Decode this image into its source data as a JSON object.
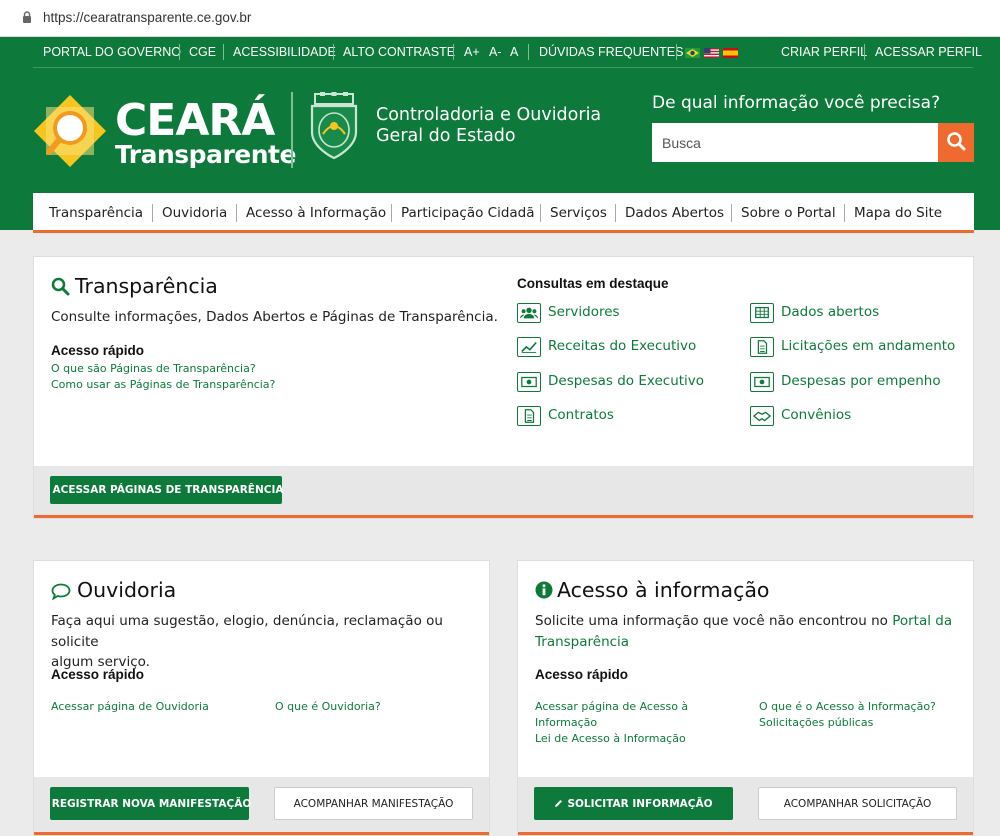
{
  "browser": {
    "url": "https://cearatransparente.ce.gov.br"
  },
  "topbar": {
    "items": [
      "PORTAL DO GOVERNO",
      "CGE",
      "ACESSIBILIDADE",
      "ALTO CONTRASTE",
      "A+",
      "A-",
      "A",
      "DÚVIDAS FREQUENTES"
    ],
    "right": [
      "CRIAR PERFIL",
      "ACESSAR PERFIL"
    ]
  },
  "brand": {
    "name": "CEARÁ",
    "subtitle": "Transparente",
    "org_line1": "Controladoria e Ouvidoria",
    "org_line2": "Geral do Estado"
  },
  "search": {
    "label": "De qual informação você precisa?",
    "placeholder": "Busca"
  },
  "nav": [
    "Transparência",
    "Ouvidoria",
    "Acesso à Informação",
    "Participação Cidadã",
    "Serviços",
    "Dados Abertos",
    "Sobre o Portal",
    "Mapa do Site"
  ],
  "transparencia": {
    "title": "Transparência",
    "description": "Consulte informações, Dados Abertos e Páginas de Transparência.",
    "quick_title": "Acesso rápido",
    "links": [
      "O que são Páginas de Transparência?",
      "Como usar as Páginas de Transparência?"
    ],
    "featured_title": "Consultas em destaque",
    "featured": [
      "Servidores",
      "Dados abertos",
      "Receitas do Executivo",
      "Licitações em andamento",
      "Despesas do Executivo",
      "Despesas por empenho",
      "Contratos",
      "Convênios"
    ],
    "button": "ACESSAR PÁGINAS DE TRANSPARÊNCIA"
  },
  "ouvidoria": {
    "title": "Ouvidoria",
    "description_line1": "Faça aqui uma sugestão, elogio, denúncia, reclamação ou solicite",
    "description_line2": "algum serviço.",
    "quick_title": "Acesso rápido",
    "links": [
      "Acessar página de Ouvidoria",
      "O que é Ouvidoria?"
    ],
    "button_primary": "REGISTRAR NOVA MANIFESTAÇÃO",
    "button_secondary": "ACOMPANHAR MANIFESTAÇÃO"
  },
  "acesso": {
    "title": "Acesso à informação",
    "description_prefix": "Solicite uma informação que você não encontrou no",
    "description_link1": "Portal da",
    "description_link2": "Transparência",
    "quick_title": "Acesso rápido",
    "links": [
      "Acessar página de Acesso à",
      "Informação",
      "Lei de Acesso à Informação",
      "O que é o Acesso à Informação?",
      "Solicitações públicas"
    ],
    "button_primary": "SOLICITAR INFORMAÇÃO",
    "button_secondary": "ACOMPANHAR SOLICITAÇÃO"
  },
  "colors": {
    "green": "#0d7a3b",
    "orange": "#ef6a2f",
    "background": "#ebebeb"
  }
}
